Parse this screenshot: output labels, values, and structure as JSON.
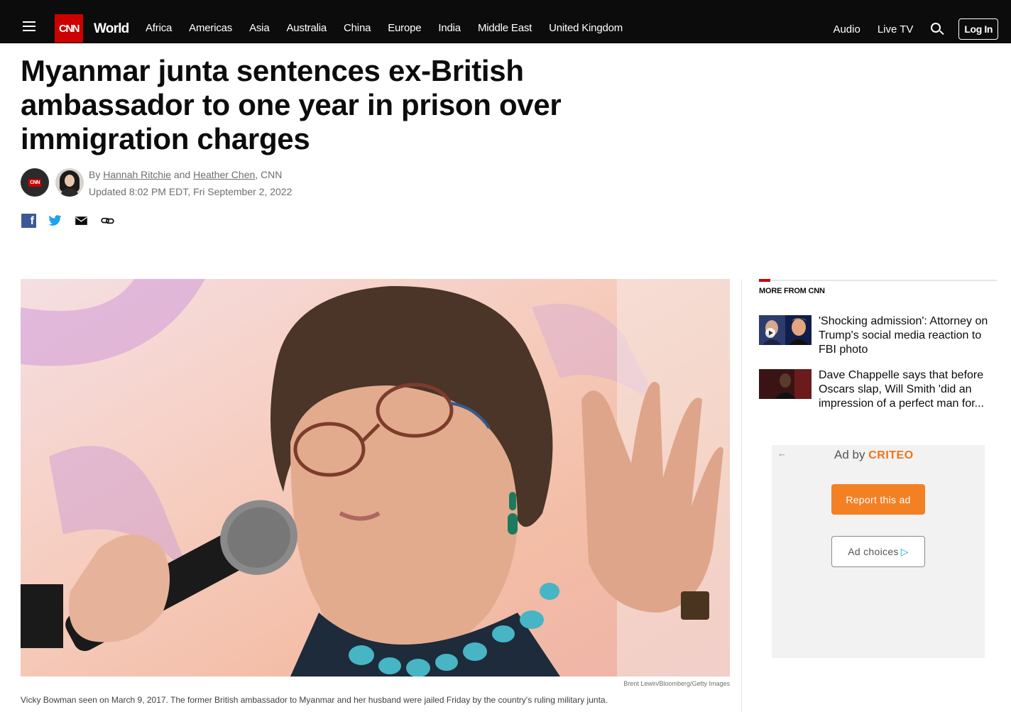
{
  "nav": {
    "logo": "CNN",
    "section": "World",
    "links": [
      "Africa",
      "Americas",
      "Asia",
      "Australia",
      "China",
      "Europe",
      "India",
      "Middle East",
      "United Kingdom"
    ],
    "right_links": [
      "Audio",
      "Live TV"
    ],
    "login": "Log In"
  },
  "article": {
    "headline": "Myanmar junta sentences ex-British ambassador to one year in prison over immigration charges",
    "byline_prefix": "By",
    "author1": "Hannah Ritchie",
    "byline_and": "and",
    "author2": "Heather Chen",
    "byline_suffix": ", CNN",
    "timestamp": "Updated 8:02 PM EDT, Fri September 2, 2022",
    "avatar_badge": "CNN",
    "image_credit": "Brent Lewin/Bloomberg/Getty Images",
    "caption": "Vicky Bowman seen on March 9, 2017. The former British ambassador to Myanmar and her husband were jailed Friday by the country's ruling military junta."
  },
  "share": {
    "facebook_glyph": "f"
  },
  "sidebar": {
    "title": "MORE FROM CNN",
    "stories": [
      {
        "text": "'Shocking admission': Attorney on Trump's social media reaction to FBI photo"
      },
      {
        "text": "Dave Chappelle says that before Oscars slap, Will Smith 'did an impression of a perfect man for..."
      }
    ]
  },
  "ad": {
    "back": "←",
    "ad_by": "Ad by",
    "brand": "CRITEO",
    "report": "Report this ad",
    "choices": "Ad choices",
    "choices_glyph": "▷"
  },
  "colors": {
    "brand_red": "#cc0000",
    "nav_bg": "#0c0c0c",
    "criteo_orange": "#f47216"
  }
}
